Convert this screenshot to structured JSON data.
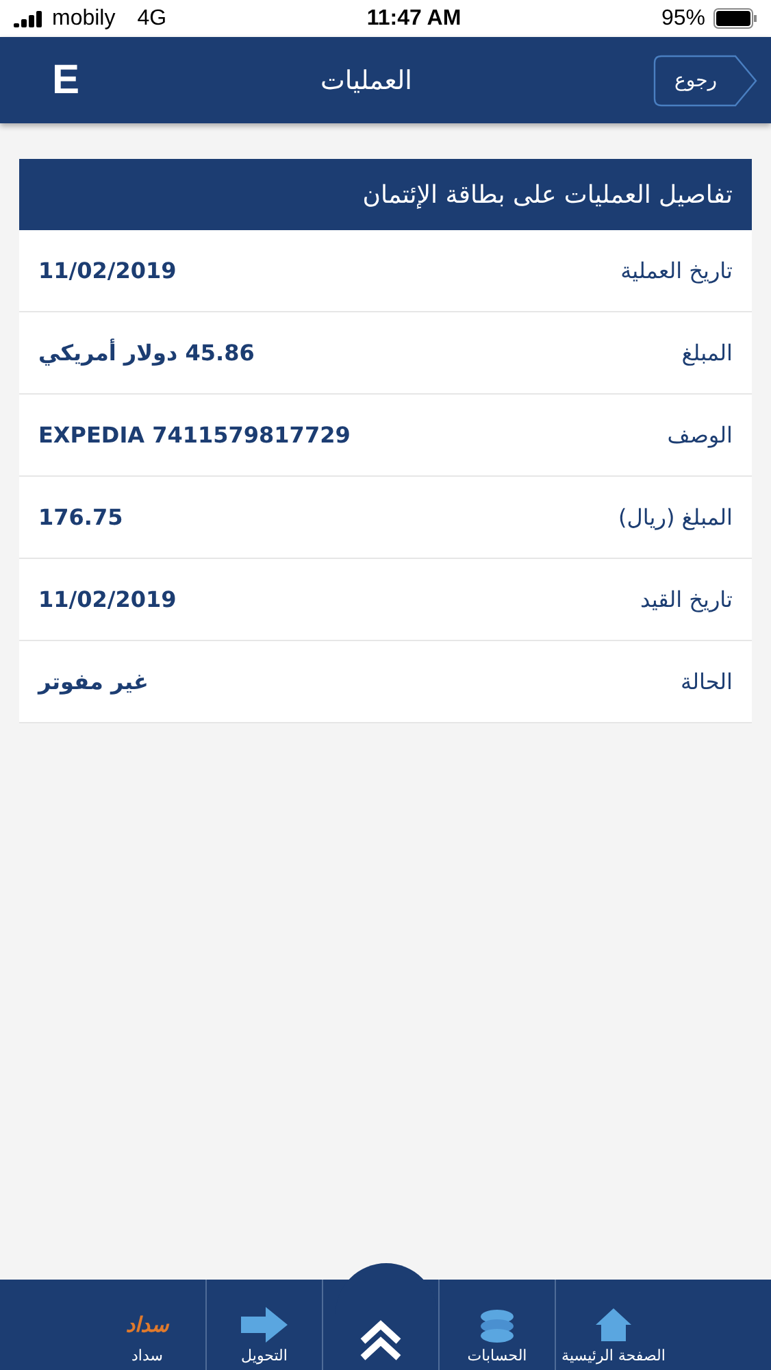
{
  "status_bar": {
    "carrier": "mobily",
    "network": "4G",
    "time": "11:47 AM",
    "battery": "95%"
  },
  "header": {
    "title": "العمليات",
    "back": "رجوع",
    "logo": "E"
  },
  "card": {
    "title": "تفاصيل العمليات على بطاقة الإئتمان",
    "rows": [
      {
        "label": "تاريخ العملية",
        "value": "11/02/2019"
      },
      {
        "label": "المبلغ",
        "value": "45.86 دولار أمريكي"
      },
      {
        "label": "الوصف",
        "value": "EXPEDIA 7411579817729"
      },
      {
        "label": "المبلغ (ريال)",
        "value": "176.75"
      },
      {
        "label": "تاريخ القيد",
        "value": "11/02/2019"
      },
      {
        "label": "الحالة",
        "value": "غير مفوتر"
      }
    ]
  },
  "bottom_nav": [
    {
      "kind": "home",
      "label": "الصفحة الرئيسية"
    },
    {
      "kind": "accounts",
      "label": "الحسابات"
    },
    {
      "kind": "center"
    },
    {
      "kind": "transfer",
      "label": "التحويل"
    },
    {
      "kind": "sadad",
      "logo": "سداد",
      "label": "سداد"
    }
  ]
}
